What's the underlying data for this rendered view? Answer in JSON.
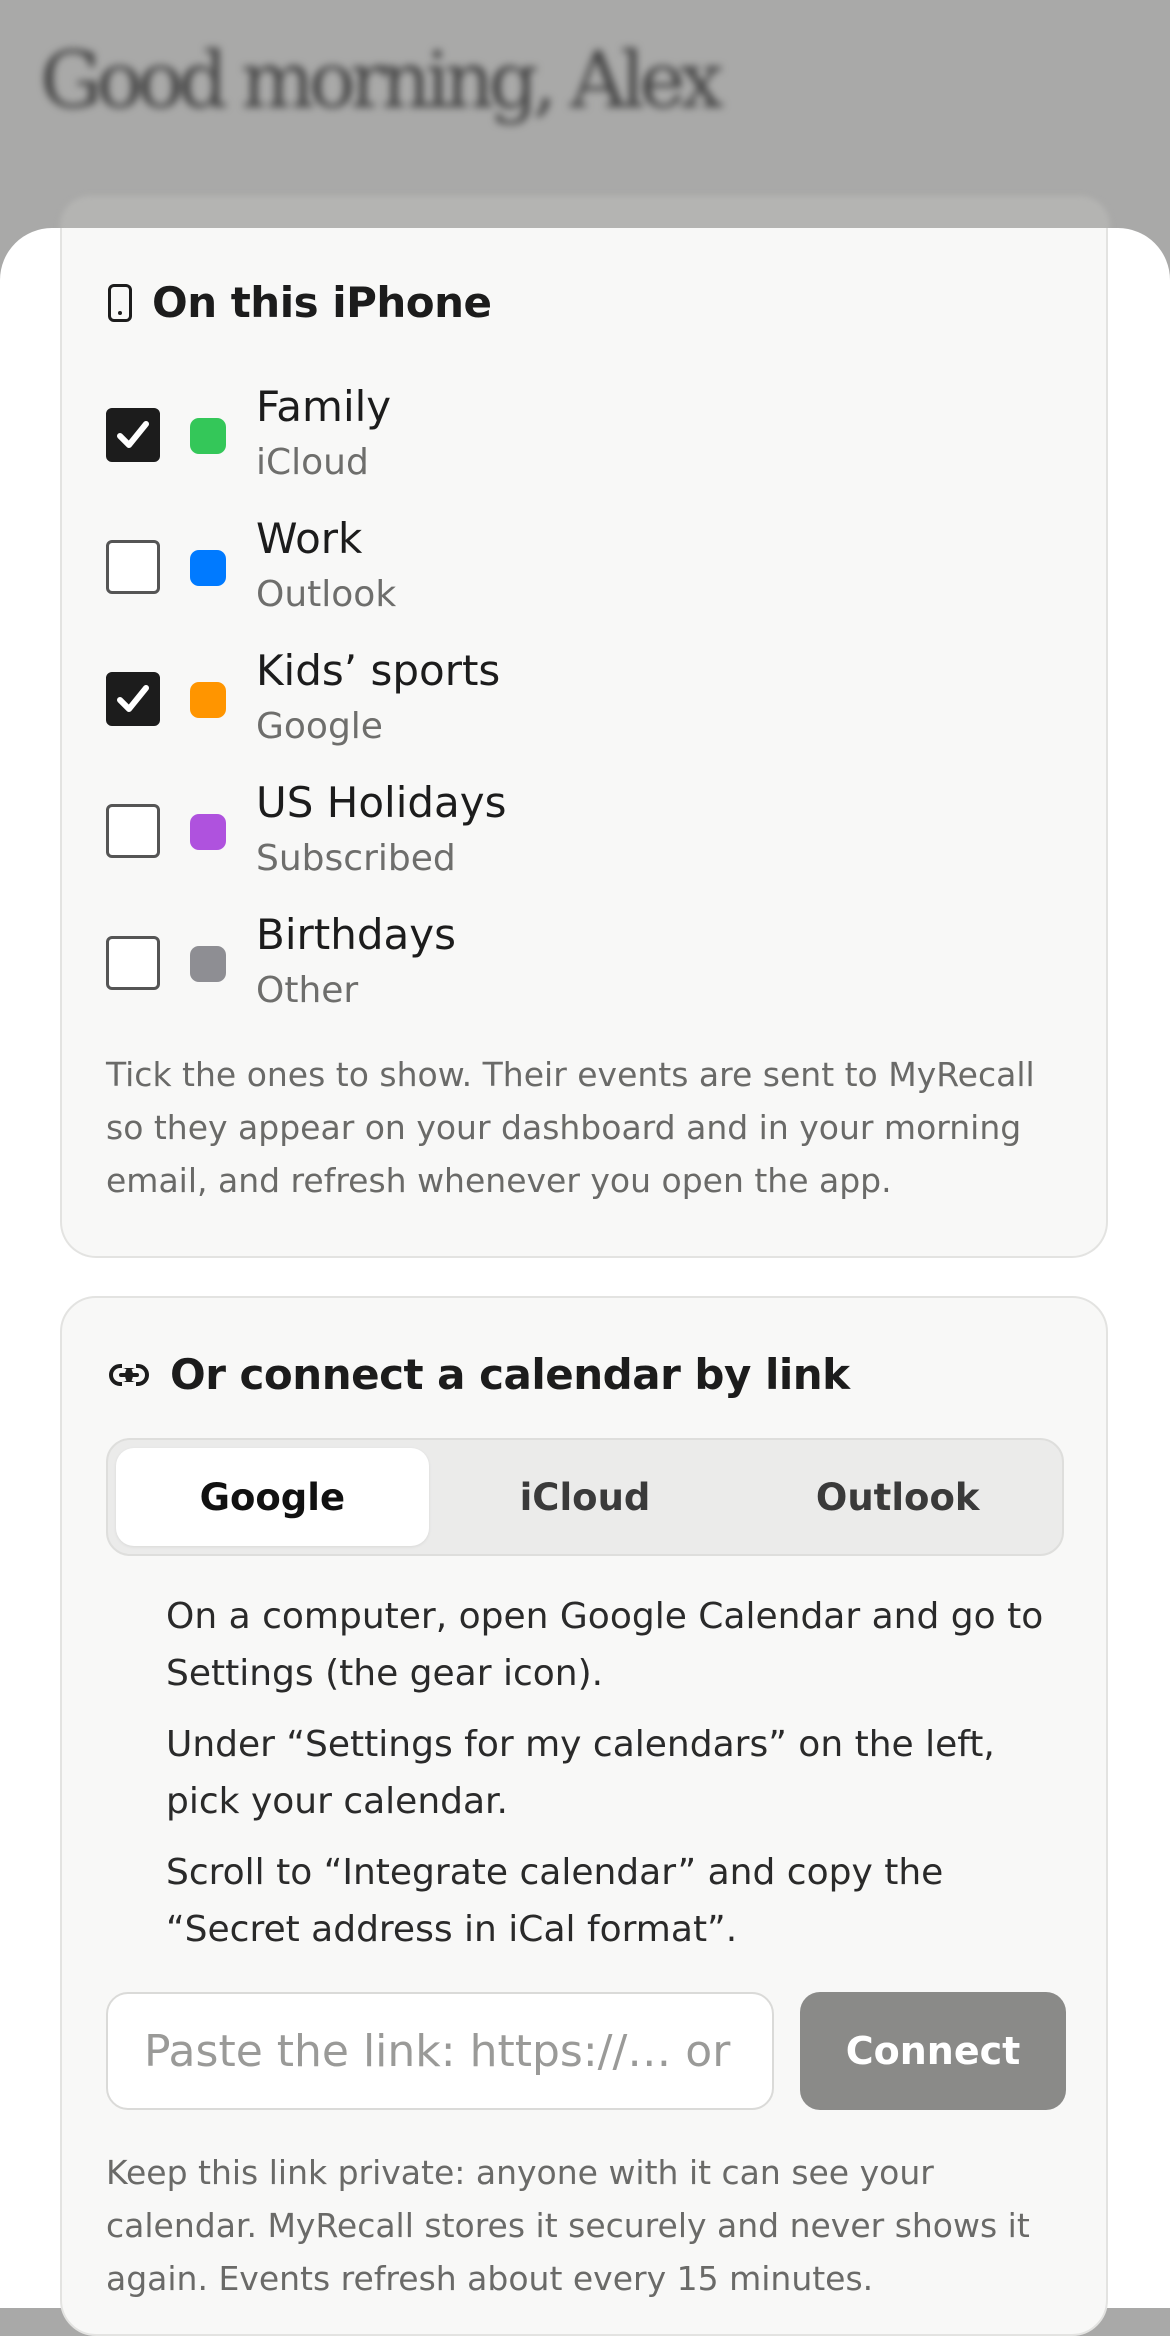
{
  "background": {
    "greeting": "Good morning, Alex"
  },
  "iphone_section": {
    "title": "On this iPhone",
    "icon": "phone-icon",
    "calendars": [
      {
        "name": "Family",
        "source": "iCloud",
        "checked": true,
        "color": "#34C759"
      },
      {
        "name": "Work",
        "source": "Outlook",
        "checked": false,
        "color": "#007AFF"
      },
      {
        "name": "Kids’ sports",
        "source": "Google",
        "checked": true,
        "color": "#FF9500"
      },
      {
        "name": "US Holidays",
        "source": "Subscribed",
        "checked": false,
        "color": "#AF52DE"
      },
      {
        "name": "Birthdays",
        "source": "Other",
        "checked": false,
        "color": "#8E8E93"
      }
    ],
    "footnote": "Tick the ones to show. Their events are sent to MyRecall so they appear on your dashboard and in your morning email, and refresh whenever you open the app."
  },
  "link_section": {
    "title": "Or connect a calendar by link",
    "icon": "link-icon",
    "tabs": [
      {
        "label": "Google",
        "active": true
      },
      {
        "label": "iCloud",
        "active": false
      },
      {
        "label": "Outlook",
        "active": false
      }
    ],
    "steps": [
      "On a computer, open Google Calendar and go to Settings (the gear icon).",
      "Under “Settings for my calendars” on the left, pick your calendar.",
      "Scroll to “Integrate calendar” and copy the “Secret address in iCal format”."
    ],
    "input": {
      "value": "",
      "placeholder": "Paste the link: https://… or webcal://…"
    },
    "connect_label": "Connect",
    "footnote": "Keep this link private: anyone with it can see your calendar. MyRecall stores it securely and never shows it again. Events refresh about every 15 minutes."
  }
}
